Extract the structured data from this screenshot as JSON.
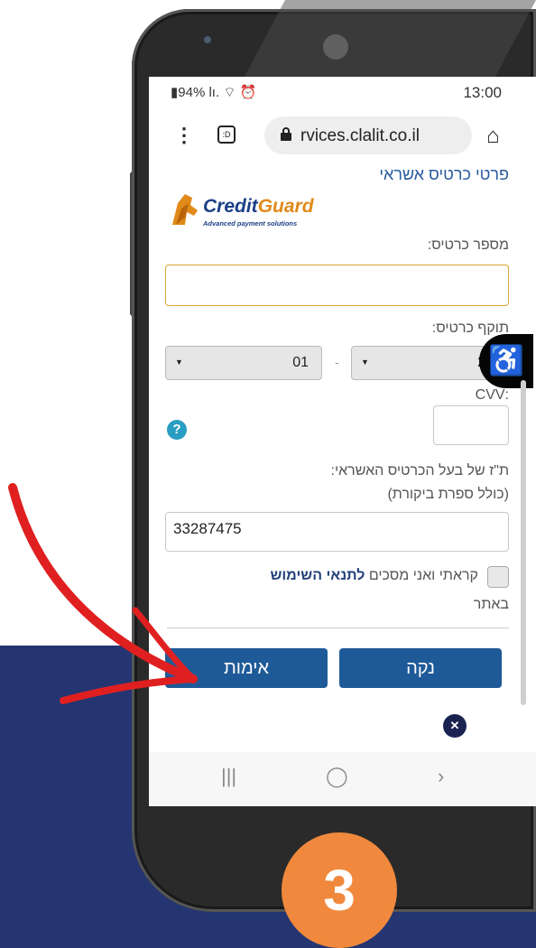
{
  "status": {
    "battery": "94%",
    "signal": "lı.",
    "time": "13:00"
  },
  "browser": {
    "menu": "⋮",
    "tabs_label": ":D",
    "url": "rvices.clalit.co.il",
    "home": "⌂"
  },
  "form": {
    "title": "פרטי כרטיס אשראי",
    "logo": {
      "word_a": "Credit",
      "word_b": "Guard",
      "tagline": "Advanced payment solutions"
    },
    "card_number_label": "מספר כרטיס:",
    "card_number_value": "",
    "expiry_label": "תוקף כרטיס:",
    "expiry_month": "01",
    "expiry_year": "2",
    "expiry_sep": "-",
    "cvv_label": ":CVV",
    "cvv_value": "",
    "help": "?",
    "id_label": "ת\"ז של בעל הכרטיס האשראי:",
    "id_sublabel": "(כולל ספרת ביקורת)",
    "id_value": "33287475",
    "terms_prefix": "קראתי ואני מסכים",
    "terms_link": "לתנאי השימוש",
    "terms_suffix": "באתר",
    "clear_button": "נקה",
    "verify_button": "אימות"
  },
  "nav": {
    "recent": "|||",
    "home": "◯",
    "back": "›"
  },
  "step_number": "3",
  "colors": {
    "band": "#243572",
    "button": "#1f5a98",
    "badge": "#f0893d",
    "arrow": "#e02020"
  }
}
